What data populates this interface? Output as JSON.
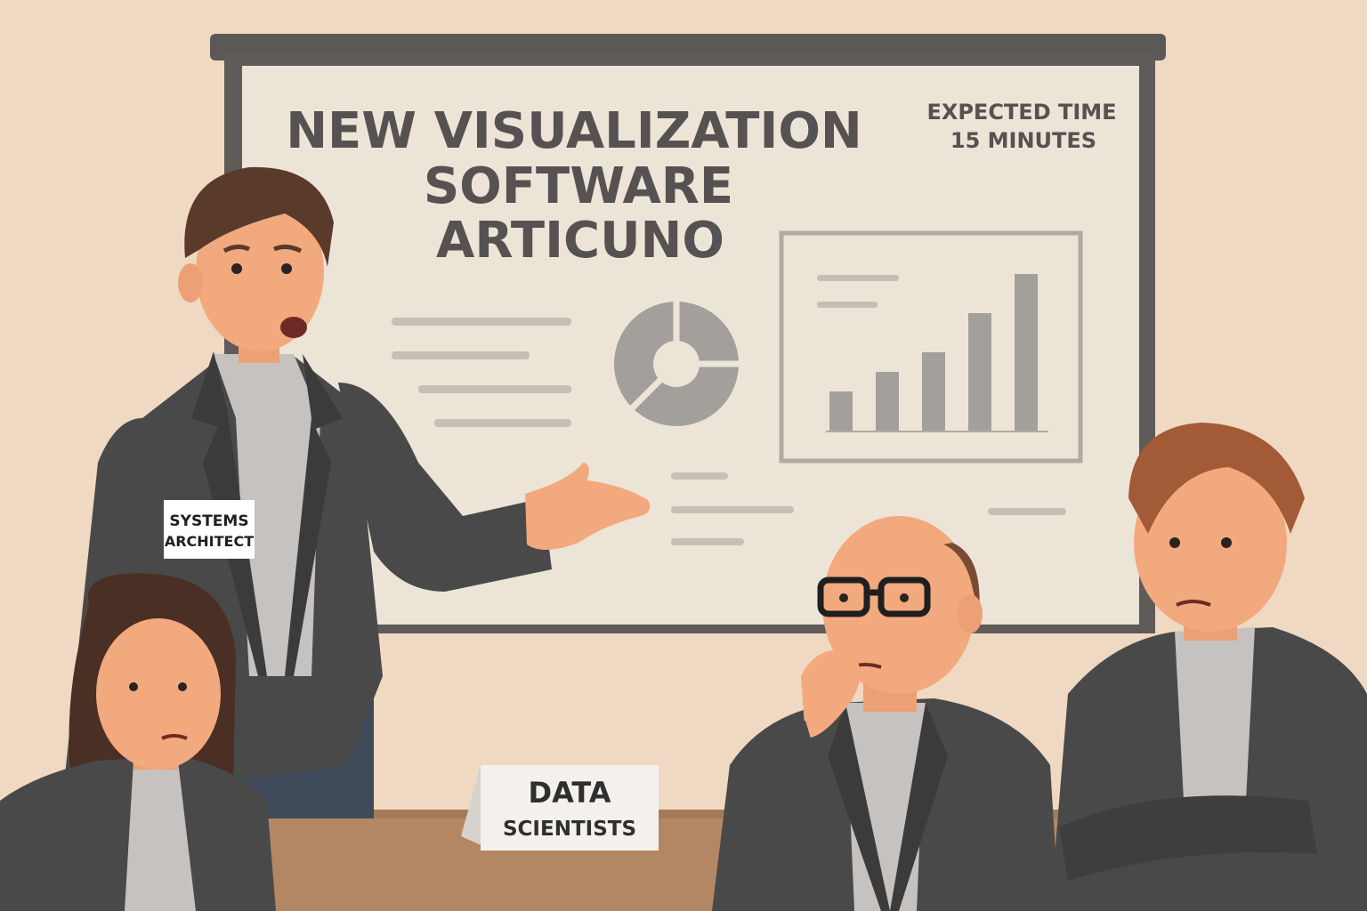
{
  "screen": {
    "title_lines": [
      "NEW VISUALIZATION",
      "SOFTWARE",
      "ARTICUNO"
    ],
    "time_lines": [
      "EXPECTED TIME",
      "15 MINUTES"
    ]
  },
  "presenter_badge": {
    "lines": [
      "SYSTEMS",
      "ARCHITECT"
    ]
  },
  "table_sign": {
    "lines": [
      "DATA",
      "SCIENTISTS"
    ]
  },
  "bar_chart": {
    "values": [
      2,
      3,
      4,
      6,
      8
    ]
  },
  "colors": {
    "wall": "#efd9c2",
    "screen": "#ede4d8",
    "frame": "#5b5855",
    "suit": "#4a4949",
    "table": "#b48764",
    "text": "#555251"
  }
}
